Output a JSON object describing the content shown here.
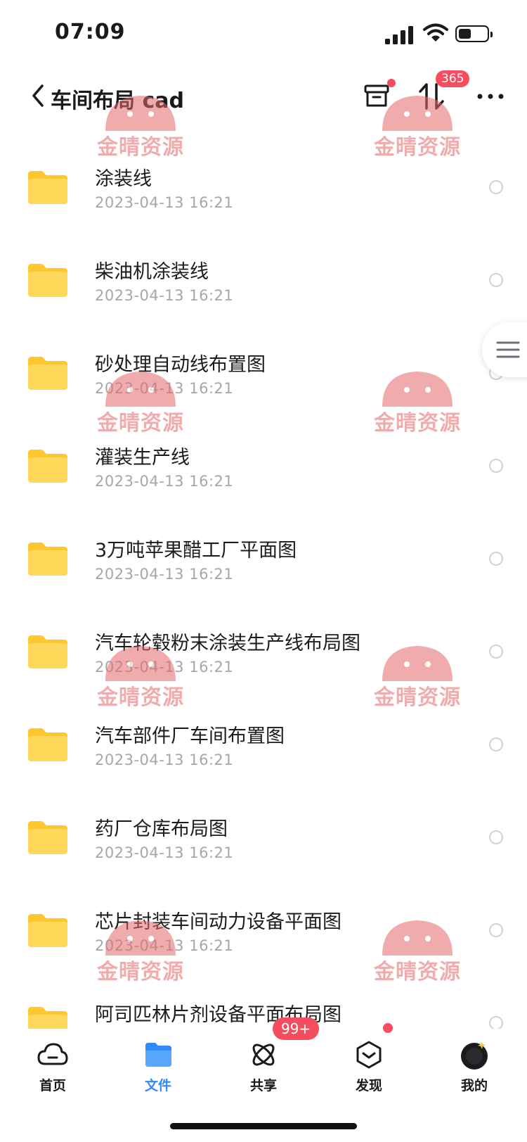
{
  "status_bar": {
    "time": "07:09"
  },
  "header": {
    "title": "车间布局 cad",
    "transfer_badge": "365"
  },
  "files": [
    {
      "name": "涂装线",
      "date": "2023-04-13 16:21"
    },
    {
      "name": "柴油机涂装线",
      "date": "2023-04-13 16:21"
    },
    {
      "name": "砂处理自动线布置图",
      "date": "2023-04-13 16:21"
    },
    {
      "name": "灌装生产线",
      "date": "2023-04-13 16:21"
    },
    {
      "name": "3万吨苹果醋工厂平面图",
      "date": "2023-04-13 16:21"
    },
    {
      "name": "汽车轮毂粉末涂装生产线布局图",
      "date": "2023-04-13 16:21"
    },
    {
      "name": "汽车部件厂车间布置图",
      "date": "2023-04-13 16:21"
    },
    {
      "name": "药厂仓库布局图",
      "date": "2023-04-13 16:21"
    },
    {
      "name": "芯片封装车间动力设备平面图",
      "date": "2023-04-13 16:21"
    },
    {
      "name": "阿司匹林片剂设备平面布局图",
      "date": ""
    }
  ],
  "watermark": {
    "text": "金晴资源"
  },
  "tabs": [
    {
      "label": "首页",
      "icon": "cloud-icon"
    },
    {
      "label": "文件",
      "icon": "folder-icon",
      "active": true
    },
    {
      "label": "共享",
      "icon": "share-icon",
      "badge": "99+"
    },
    {
      "label": "发现",
      "icon": "discover-icon"
    },
    {
      "label": "我的",
      "icon": "avatar-icon"
    }
  ],
  "colors": {
    "accent": "#2f8bf5",
    "badge": "#f44d5f",
    "folder": "#ffce3d",
    "date": "#a4a7ad"
  }
}
